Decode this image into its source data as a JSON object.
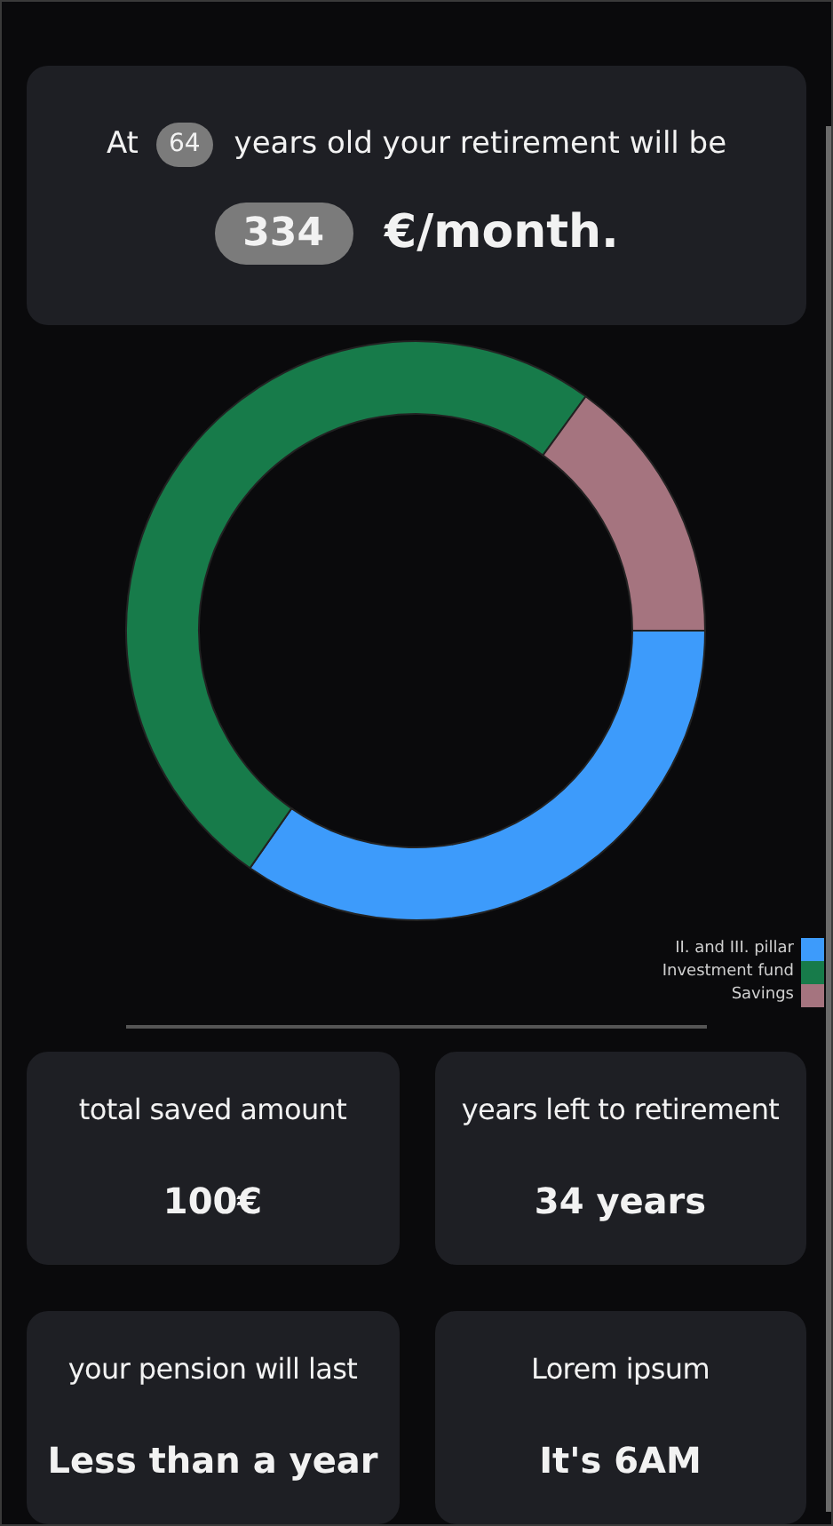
{
  "header": {
    "prefix": "At",
    "age": "64",
    "middle": "years old your retirement will be",
    "amount": "334",
    "unit": "€/month."
  },
  "legend": [
    {
      "label": "II. and III. pillar",
      "color": "#3d9bfb"
    },
    {
      "label": "Investment fund",
      "color": "#177b4a"
    },
    {
      "label": "Savings",
      "color": "#a5747f"
    }
  ],
  "stats": [
    {
      "label": "total saved amount",
      "value": "100€"
    },
    {
      "label": "years left to retirement",
      "value": "34 years"
    },
    {
      "label": "your pension will last",
      "value": "Less than a year"
    },
    {
      "label": "Lorem ipsum",
      "value": "It's 6AM"
    }
  ]
}
